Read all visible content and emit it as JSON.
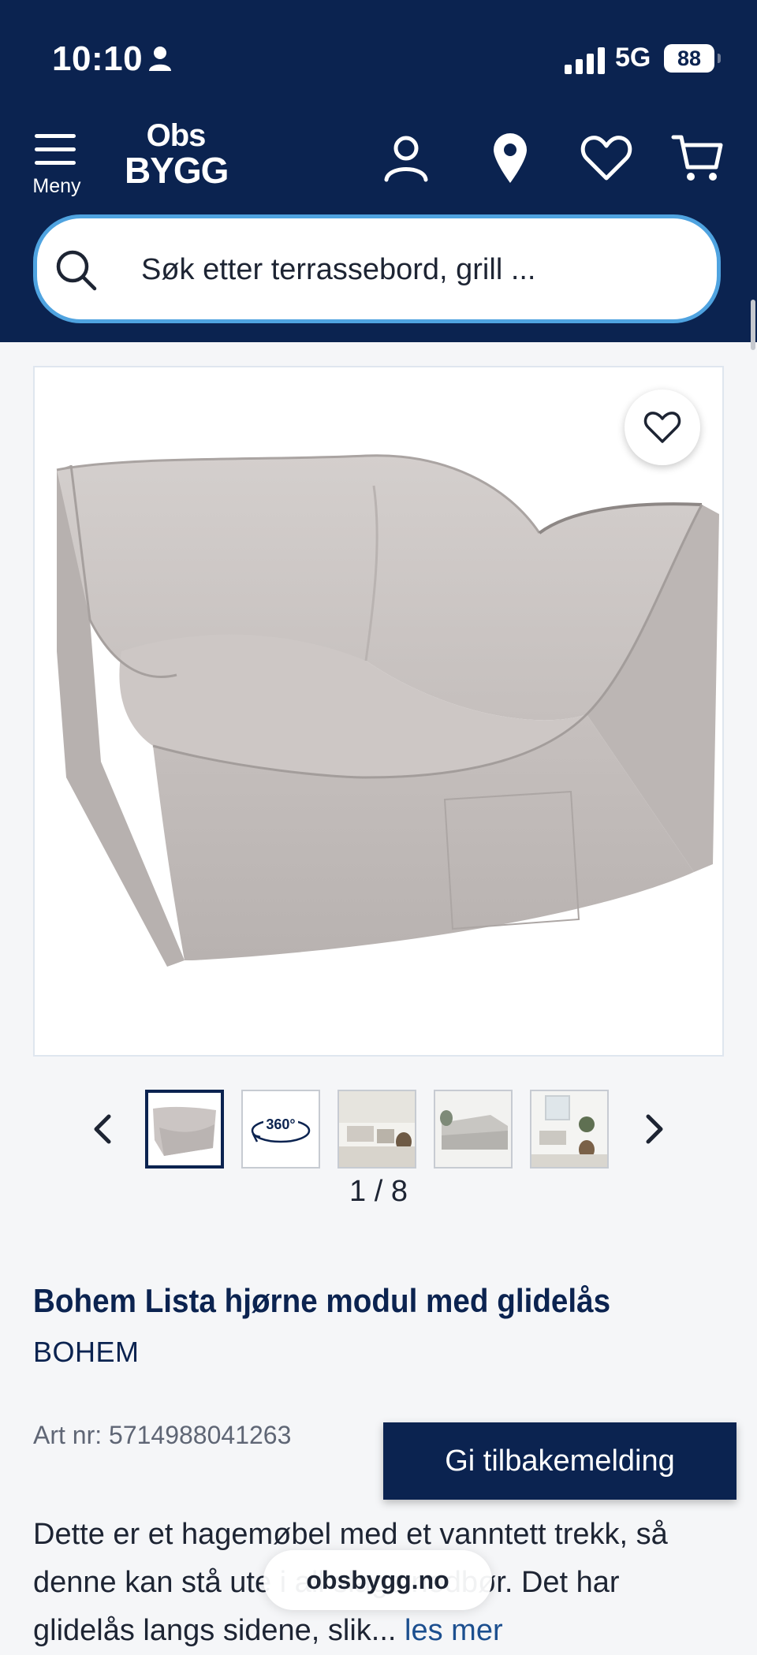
{
  "status_bar": {
    "time": "10:10",
    "network": "5G",
    "battery": "88"
  },
  "header": {
    "menu_label": "Meny",
    "logo_top": "Obs",
    "logo_bottom": "BYGG",
    "search_placeholder": "Søk etter terrassebord, grill ..."
  },
  "gallery": {
    "counter": "1 / 8",
    "thumbnails": [
      {
        "icon": "chair-thumbnail"
      },
      {
        "icon": "360-view-icon",
        "label": "360°"
      },
      {
        "icon": "lounge-scene-thumbnail"
      },
      {
        "icon": "sofa-scene-thumbnail"
      },
      {
        "icon": "patio-scene-thumbnail"
      }
    ]
  },
  "product": {
    "title": "Bohem Lista hjørne modul med glidelås",
    "brand": "BOHEM",
    "art_nr": "Art nr: 5714988041263",
    "description": "Dette er et hagemøbel med et vanntett trekk, så denne kan stå ute i all slags nedbør. Det har glidelås langs sidene, slik...",
    "read_more": "les mer"
  },
  "feedback_button": "Gi tilbakemelding",
  "browser": {
    "url": "obsbygg.no"
  },
  "colors": {
    "brand_navy": "#0b2350",
    "search_border": "#4fa3e0",
    "link_blue": "#1c4f8f"
  }
}
